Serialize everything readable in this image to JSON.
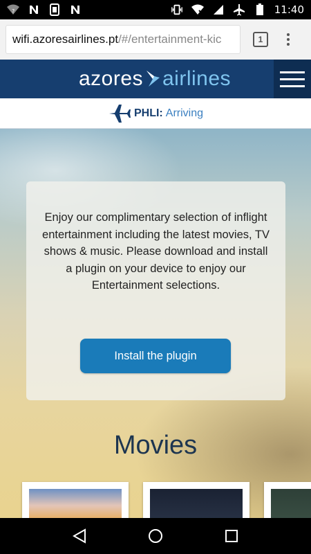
{
  "status_bar": {
    "time": "11:40",
    "left_icons": [
      "wifi-question-icon",
      "n-notification-icon",
      "sim-icon",
      "n-notification-icon"
    ],
    "right_icons": [
      "vibrate-icon",
      "wifi-x-icon",
      "signal-icon",
      "airplane-mode-icon",
      "battery-icon"
    ]
  },
  "browser": {
    "url_host": "wifi.azoresairlines.pt",
    "url_path": "/#/entertainment-kic",
    "tab_count": "1"
  },
  "header": {
    "logo_word1": "azores",
    "logo_word2": "airlines"
  },
  "flight": {
    "code": "PHLI:",
    "status": "Arriving"
  },
  "main": {
    "intro_text": "Enjoy our complimentary selection of inflight entertainment including the latest movies, TV shows & music. Please download and install a plugin on your device to enjoy our Entertainment selections.",
    "install_button": "Install the plugin",
    "movies_title": "Movies"
  },
  "colors": {
    "header_bg": "#163e6f",
    "accent_blue": "#1a7bb9",
    "logo_light": "#7fc4ee"
  }
}
